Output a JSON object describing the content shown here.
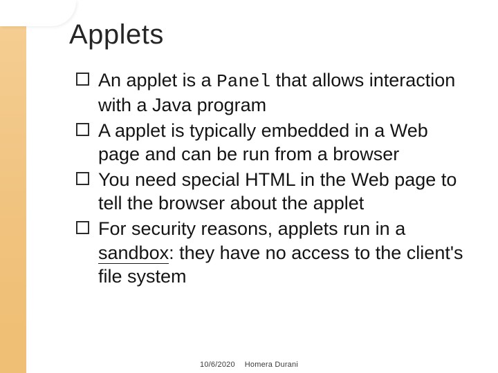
{
  "title": "Applets",
  "bullets": [
    {
      "pre": "An applet is a ",
      "panel": "Panel",
      "post": " that allows interaction with a Java program"
    },
    {
      "text": "A applet is typically embedded in a Web page and can be run from a browser"
    },
    {
      "text": "You need special HTML in the Web page to tell the browser about the applet"
    },
    {
      "pre": "For security reasons, applets run in a ",
      "sandbox": "sandbox",
      "post": ": they have no access to the client's file system"
    }
  ],
  "footer": {
    "date": "10/6/2020",
    "author": "Homera Durani"
  }
}
